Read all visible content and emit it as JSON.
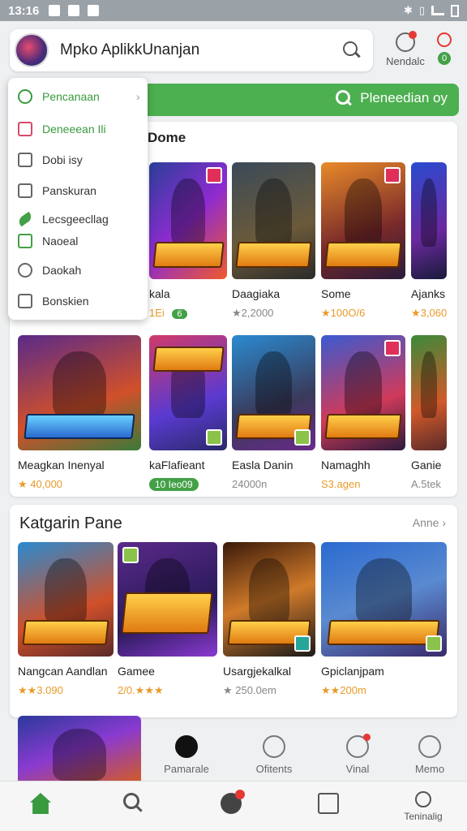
{
  "status_bar": {
    "time": "13:16"
  },
  "header": {
    "title": "Mpko AplikkUnanjan",
    "notification_label": "Nendalc",
    "gift_count": "0"
  },
  "search_banner": {
    "label": "Pleneedian oy"
  },
  "dropdown": {
    "items": [
      {
        "label": "Pencanaan",
        "icon": "search-icon"
      },
      {
        "label": "Deneeean Ili",
        "icon": "square-icon"
      },
      {
        "label": "Dobi isy",
        "icon": "square-icon"
      },
      {
        "label": "Panskuran",
        "icon": "square-icon"
      },
      {
        "label": "Lecsgeecllag",
        "icon": "leaf-icon"
      },
      {
        "label": "Naoeal",
        "icon": "square-icon"
      },
      {
        "label": "Daokah",
        "icon": "person-icon"
      },
      {
        "label": "Bonskien",
        "icon": "square-icon"
      }
    ]
  },
  "section1": {
    "title": "Dome",
    "row1": [
      {
        "name": "kala",
        "meta": "1Ei",
        "tag": "6"
      },
      {
        "name": "Daagiaka",
        "meta": "★2,2000"
      },
      {
        "name": "Some",
        "meta": "★100O/6"
      },
      {
        "name": "Ajanks",
        "meta": "★3,060"
      }
    ],
    "row2": [
      {
        "name": "Meagkan Inenyal",
        "meta": "★ 40,000"
      },
      {
        "name": "kaFlafieant",
        "meta": "10 Ieo09"
      },
      {
        "name": "Easla Danin",
        "meta": "24000n"
      },
      {
        "name": "Namaghh",
        "meta": "S3.agen"
      },
      {
        "name": "Ganie",
        "meta": "A.5tek"
      }
    ]
  },
  "section2": {
    "title": "Katgarin Pane",
    "see_all": "Anne",
    "row": [
      {
        "name": "Nangcan Aandlan",
        "meta": "★★3.090"
      },
      {
        "name": "Gamee",
        "meta": "2/0.★★★"
      },
      {
        "name": "Usargjekalkal",
        "meta": "★ 250.0em"
      },
      {
        "name": "Gpiclanjpam",
        "meta": "★★200m"
      }
    ]
  },
  "mid_tabs": [
    {
      "label": "Pamarale",
      "icon": "sword-icon"
    },
    {
      "label": "Ofitents",
      "icon": "smile-icon"
    },
    {
      "label": "Vinal",
      "icon": "user-icon"
    },
    {
      "label": "Memo",
      "icon": "user-plus-icon"
    }
  ],
  "bottom_nav": [
    {
      "label": "",
      "icon": "home-icon"
    },
    {
      "label": "",
      "icon": "search-icon"
    },
    {
      "label": "",
      "icon": "games-icon"
    },
    {
      "label": "",
      "icon": "bag-icon"
    },
    {
      "label": "Teninalig",
      "icon": "profile-icon"
    }
  ],
  "colors": {
    "accent": "#4caf50",
    "star": "#e89a2a",
    "alert": "#e53935"
  }
}
